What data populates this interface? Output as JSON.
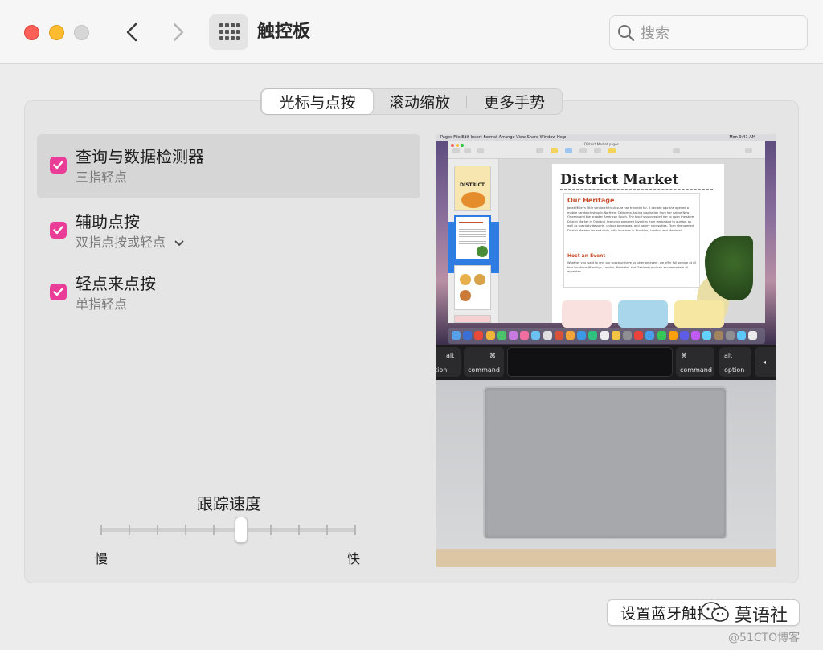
{
  "window": {
    "title": "触控板",
    "search_placeholder": "搜索"
  },
  "tabs": [
    {
      "label": "光标与点按",
      "selected": true
    },
    {
      "label": "滚动缩放",
      "selected": false
    },
    {
      "label": "更多手势",
      "selected": false
    }
  ],
  "options": [
    {
      "title": "查询与数据检测器",
      "subtitle": "三指轻点",
      "checked": true,
      "selected": true
    },
    {
      "title": "辅助点按",
      "subtitle": "双指点按或轻点",
      "checked": true,
      "selected": false,
      "has_dropdown": true
    },
    {
      "title": "轻点来点按",
      "subtitle": "单指轻点",
      "checked": true,
      "selected": false
    }
  ],
  "tracking": {
    "label": "跟踪速度",
    "min_label": "慢",
    "max_label": "快",
    "value_fraction": 0.55,
    "tick_count": 10
  },
  "preview": {
    "menubar": {
      "items": [
        "Pages",
        "File",
        "Edit",
        "Insert",
        "Format",
        "Arrange",
        "View",
        "Share",
        "Window",
        "Help"
      ],
      "clock": "Mon 9:41 AM"
    },
    "window_title": "District Market.pages",
    "doc": {
      "title": "District Market",
      "heading1": "Our Heritage",
      "para1": "Janet Millet's little sandwich truck sure has traveled far. A decade ago she opened a mobile sandwich shop in Northern California, taking inspiration from her native New Orleans and the broader American South. The truck's success led her to open the store District Market in Oakland, featuring prepared favorites from jambalaya to gumbo, as well as specialty desserts, unique beverages, and pantry necessities. Then she opened District Markets far and wide, with locations in Brooklyn, London, and Montréal.",
      "heading2": "Host an Event",
      "para2": "Whether you want to rent our space or have us cater an event, we offer full service at all four locations (Brooklyn, London, Montréal, and Oakland) and can accommodate all appetites."
    },
    "thumb_label": "DISTRICT",
    "keys": [
      {
        "sym": "alt",
        "label": "option"
      },
      {
        "sym": "⌘",
        "label": "command"
      },
      {
        "sym": "⌘",
        "label": "command"
      },
      {
        "sym": "alt",
        "label": "option"
      },
      {
        "sym": "◂",
        "label": ""
      }
    ]
  },
  "bluetooth_button": "设置蓝牙触控板",
  "watermark": {
    "badge": "莫语社",
    "site": "@51CTO博客"
  },
  "colors": {
    "checkbox": "#ea3d97",
    "close": "#fe5f57",
    "minimize": "#febc2e",
    "maximize_disabled": "#d6d6d6"
  }
}
